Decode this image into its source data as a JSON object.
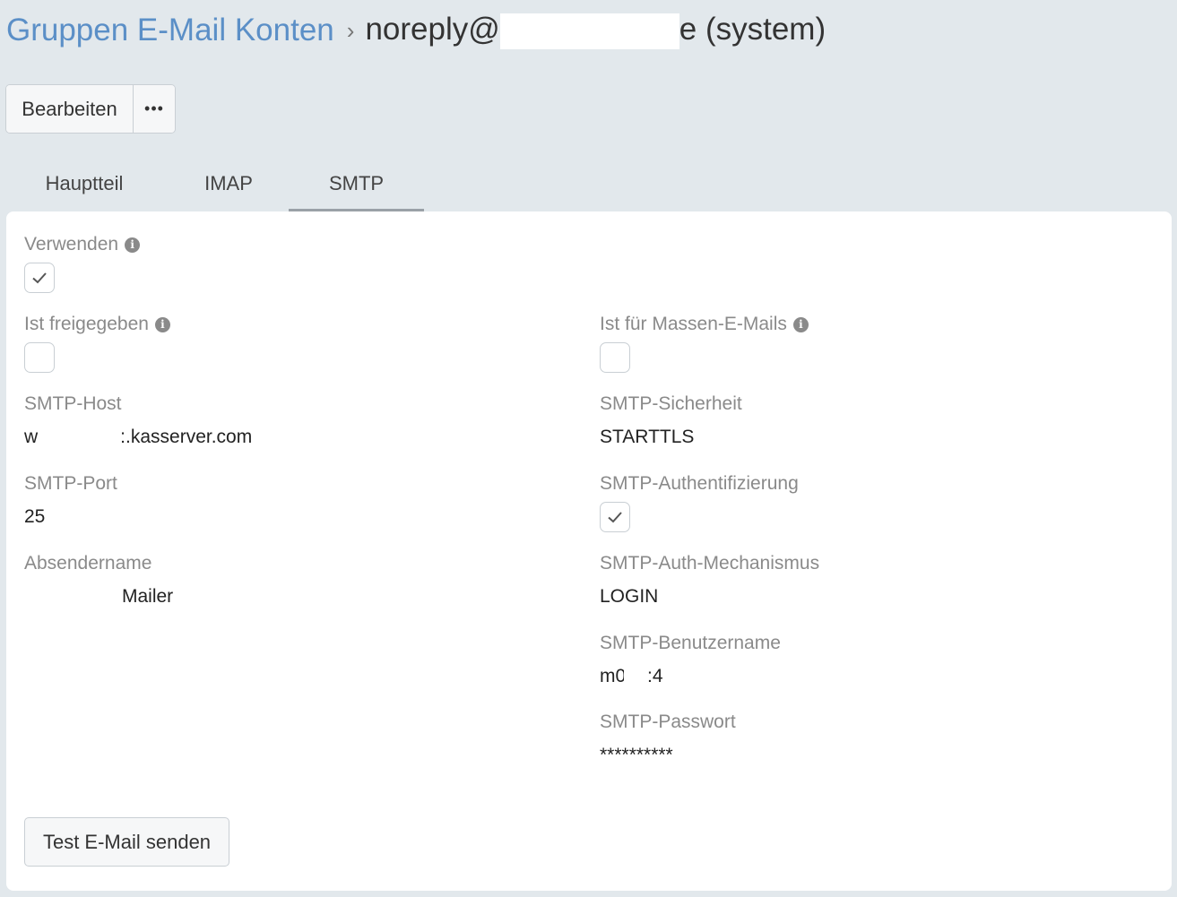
{
  "breadcrumb": {
    "parent": "Gruppen E-Mail Konten",
    "separator": "›",
    "current_prefix": "noreply@",
    "current_suffix": "e (system)"
  },
  "actions": {
    "edit_label": "Bearbeiten",
    "more_label": "•••"
  },
  "tabs": [
    {
      "label": "Hauptteil",
      "active": false
    },
    {
      "label": "IMAP",
      "active": false
    },
    {
      "label": "SMTP",
      "active": true
    }
  ],
  "fields": {
    "use": {
      "label": "Verwenden",
      "checked": true
    },
    "shared": {
      "label": "Ist freigegeben",
      "checked": false
    },
    "mass_email": {
      "label": "Ist für Massen-E-Mails",
      "checked": false
    },
    "smtp_host": {
      "label": "SMTP-Host",
      "value_prefix": "w",
      "value_suffix": ":.kasserver.com"
    },
    "smtp_security": {
      "label": "SMTP-Sicherheit",
      "value": "STARTTLS"
    },
    "smtp_port": {
      "label": "SMTP-Port",
      "value": "25"
    },
    "smtp_auth": {
      "label": "SMTP-Authentifizierung",
      "checked": true
    },
    "sender_name": {
      "label": "Absendername",
      "value": "Mailer"
    },
    "smtp_auth_mech": {
      "label": "SMTP-Auth-Mechanismus",
      "value": "LOGIN"
    },
    "smtp_username": {
      "label": "SMTP-Benutzername",
      "value_prefix": "m0!",
      "value_suffix": ":4"
    },
    "smtp_password": {
      "label": "SMTP-Passwort",
      "value": "**********"
    }
  },
  "test_button_label": "Test E-Mail senden",
  "icons": {
    "info": "info-icon",
    "check": "check-icon"
  }
}
